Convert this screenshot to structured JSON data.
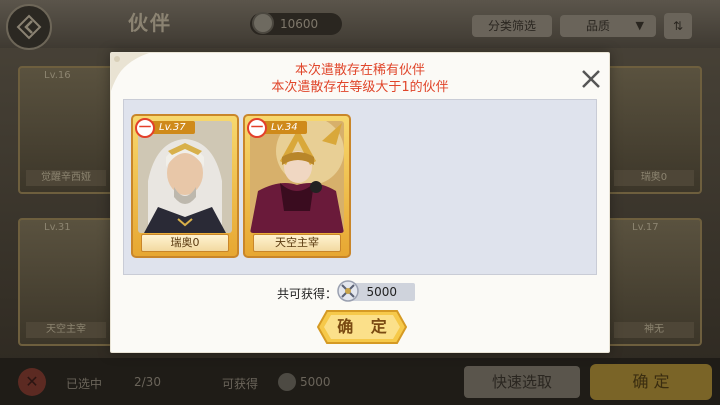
{
  "header": {
    "title": "伙伴",
    "coins": "10600",
    "filter_label": "分类筛选",
    "quality_label": "品质",
    "quality_arrow": "▼",
    "sort_icon": "sort-icon"
  },
  "background_cards": [
    {
      "name": "觉醒辛西娅",
      "level": "Lv.16"
    },
    {
      "name": "天空主宰",
      "level": "Lv.31"
    },
    {
      "name": "瑞奥0",
      "level": ""
    },
    {
      "name": "神无",
      "level": "Lv.17"
    }
  ],
  "footer": {
    "close_icon": "x-icon",
    "selected_label": "已选中",
    "selected_count": "2/30",
    "gain_label": "可获得",
    "gain_value": "5000",
    "quick_select": "快速选取",
    "confirm": "确 定"
  },
  "dialog": {
    "message_1": "本次遣散存在稀有伙伴",
    "message_2": "本次遣散存在等级大于1的伙伴",
    "cards": [
      {
        "name": "瑞奥0",
        "level": "Lv.37",
        "rarity": "一"
      },
      {
        "name": "天空主宰",
        "level": "Lv.34",
        "rarity": "一"
      }
    ],
    "total_label": "共可获得：",
    "total_value": "5000",
    "confirm": "确  定"
  },
  "colors": {
    "accent_red": "#e0452a",
    "card_gold": "#e7a732",
    "button_gold": "#f6c94a"
  }
}
